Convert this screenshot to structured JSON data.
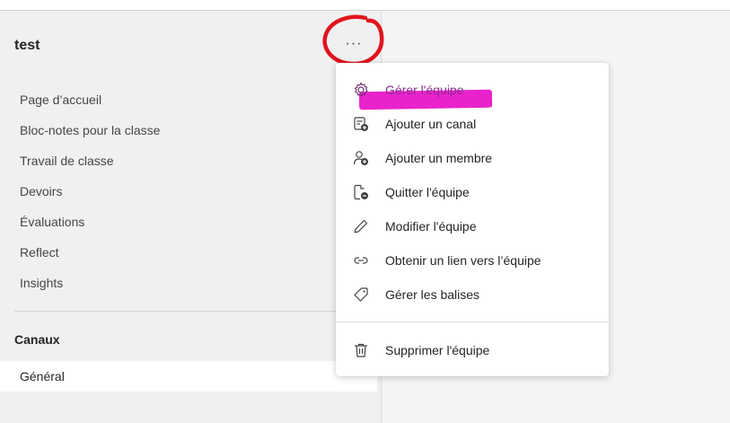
{
  "team": {
    "name": "test",
    "more_label": "···"
  },
  "nav": {
    "items": [
      "Page d’accueil",
      "Bloc-notes pour la classe",
      "Travail de classe",
      "Devoirs",
      "Évaluations",
      "Reflect",
      "Insights"
    ]
  },
  "channels": {
    "header": "Canaux",
    "items": [
      "Général"
    ]
  },
  "menu": {
    "items": [
      {
        "label": "Gérer l'équipe",
        "icon": "gear-icon"
      },
      {
        "label": "Ajouter un canal",
        "icon": "add-channel-icon"
      },
      {
        "label": "Ajouter un membre",
        "icon": "add-member-icon"
      },
      {
        "label": "Quitter l'équipe",
        "icon": "leave-icon"
      },
      {
        "label": "Modifier l'équipe",
        "icon": "pencil-icon"
      },
      {
        "label": "Obtenir un lien vers l’équipe",
        "icon": "link-icon"
      },
      {
        "label": "Gérer les balises",
        "icon": "tag-icon"
      },
      {
        "label": "Supprimer l'équipe",
        "icon": "trash-icon"
      }
    ]
  },
  "colors": {
    "annotation_red": "#e0141e",
    "highlight_magenta": "#e816c9"
  }
}
